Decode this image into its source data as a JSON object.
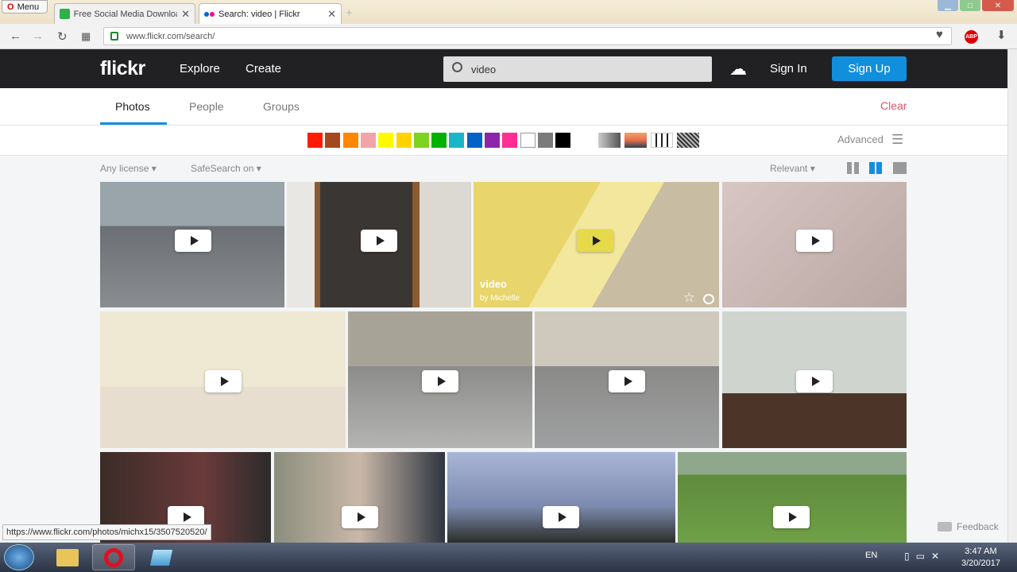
{
  "browser": {
    "menu_label": "Menu",
    "tabs": [
      {
        "title": "Free Social Media Download"
      },
      {
        "title": "Search: video | Flickr"
      }
    ],
    "url": "www.flickr.com/search/",
    "status_url": "https://www.flickr.com/photos/michx15/3507520520/"
  },
  "header": {
    "logo": "flickr",
    "explore": "Explore",
    "create": "Create",
    "search_value": "video",
    "sign_in": "Sign In",
    "sign_up": "Sign Up"
  },
  "subnav": {
    "tabs": [
      "Photos",
      "People",
      "Groups"
    ],
    "active_tab": "Photos",
    "clear": "Clear"
  },
  "color_filters": [
    "#ff1c00",
    "#a4491d",
    "#ff8600",
    "#f2a3a8",
    "#fffa00",
    "#ffd200",
    "#7ed321",
    "#00b200",
    "#19b6c8",
    "#0062c6",
    "#8e24aa",
    "#ff2e93",
    "#ffffff",
    "#7b7b7b",
    "#000000"
  ],
  "style_filters": [
    "black-and-white",
    "shallow-depth",
    "minimalist",
    "patterns"
  ],
  "advanced": "Advanced",
  "filters": {
    "license": "Any license",
    "safesearch": "SafeSearch on",
    "sort": "Relevant"
  },
  "hovered_photo": {
    "title": "video",
    "by": "by Michelle"
  },
  "feedback": "Feedback",
  "taskbar": {
    "lang": "EN",
    "time": "3:47 AM",
    "date": "3/20/2017"
  }
}
